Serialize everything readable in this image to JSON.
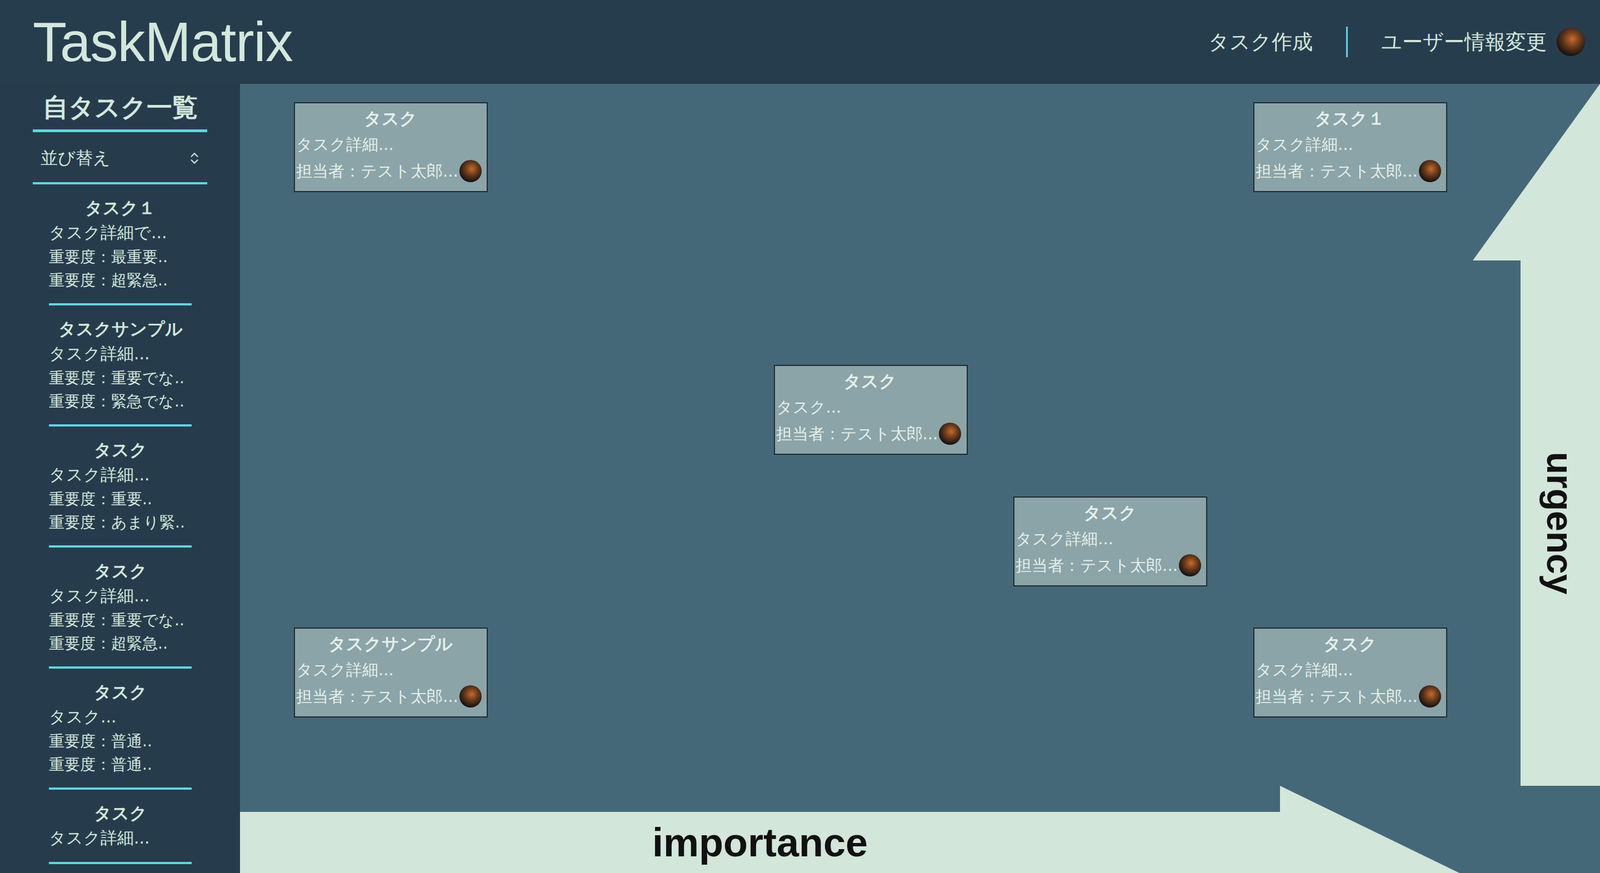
{
  "header": {
    "logo": "TaskMatrix",
    "links": [
      "タスク作成",
      "ユーザー情報変更"
    ]
  },
  "sidebar": {
    "title": "自タスク一覧",
    "sort": {
      "label": "並び替え"
    },
    "items": [
      {
        "title": "タスク１",
        "lines": [
          "タスク詳細で...",
          "重要度：最重要..",
          "重要度：超緊急.."
        ]
      },
      {
        "title": "タスクサンプル",
        "lines": [
          "タスク詳細...",
          "重要度：重要でな..",
          "重要度：緊急でな.."
        ]
      },
      {
        "title": "タスク",
        "lines": [
          "タスク詳細...",
          "重要度：重要..",
          "重要度：あまり緊.."
        ]
      },
      {
        "title": "タスク",
        "lines": [
          "タスク詳細...",
          "重要度：重要でな..",
          "重要度：超緊急.."
        ]
      },
      {
        "title": "タスク",
        "lines": [
          "タスク...",
          "重要度：普通..",
          "重要度：普通.."
        ]
      },
      {
        "title": "タスク",
        "lines": [
          "タスク詳細..."
        ]
      }
    ]
  },
  "matrix": {
    "axes": {
      "x": "importance",
      "y": "urgency"
    },
    "cards": [
      {
        "title": "タスク",
        "detail": "タスク詳細...",
        "assignee": "担当者：テスト太郎...",
        "importance": 0,
        "urgency": 1
      },
      {
        "title": "タスク１",
        "detail": "タスク詳細...",
        "assignee": "担当者：テスト太郎...",
        "importance": 1,
        "urgency": 1
      },
      {
        "title": "タスク",
        "detail": "タスク...",
        "assignee": "担当者：テスト太郎...",
        "importance": 0.5,
        "urgency": 0.5
      },
      {
        "title": "タスク",
        "detail": "タスク詳細...",
        "assignee": "担当者：テスト太郎...",
        "importance": 0.75,
        "urgency": 0.25
      },
      {
        "title": "タスクサンプル",
        "detail": "タスク詳細...",
        "assignee": "担当者：テスト太郎...",
        "importance": 0,
        "urgency": 0
      },
      {
        "title": "タスク",
        "detail": "タスク詳細...",
        "assignee": "担当者：テスト太郎...",
        "importance": 1,
        "urgency": 0
      }
    ]
  }
}
